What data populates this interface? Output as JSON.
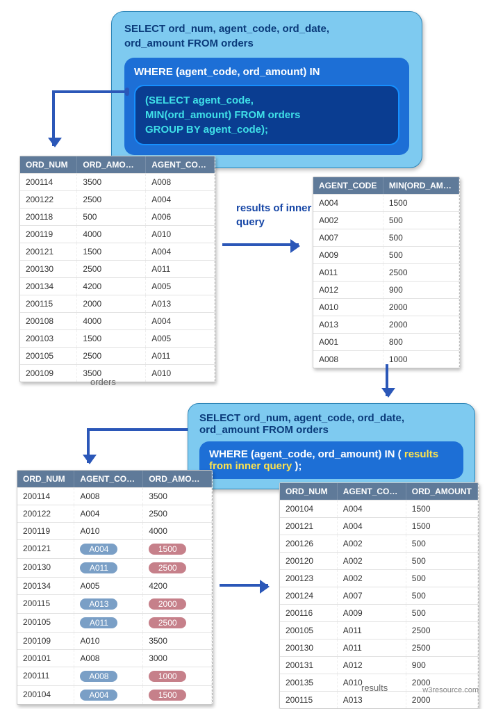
{
  "boxes": {
    "outer_l1": "SELECT ord_num, agent_code, ord_date,",
    "outer_l2": "ord_amount  FROM orders",
    "mid_l1": "WHERE (agent_code, ord_amount) IN",
    "inner_l1": "(SELECT agent_code,",
    "inner_l2": "MIN(ord_amount) FROM orders",
    "inner_l3": "GROUP BY agent_code);",
    "sql2_l1": "SELECT ord_num, agent_code, ord_date,",
    "sql2_l2": "ord_amount FROM orders",
    "sql2_where_pre": "WHERE (agent_code, ord_amount) IN ( ",
    "sql2_where_res": "results from inner query",
    "sql2_where_post": " );"
  },
  "labels": {
    "results_of_inner": "results of inner query",
    "orders_caption": "orders",
    "results_caption": "results",
    "watermark": "w3resource.com"
  },
  "orders_table": {
    "headers": [
      "ORD_NUM",
      "ORD_AMOUNT",
      "AGENT_CODE"
    ],
    "rows": [
      [
        "200114",
        "3500",
        "A008"
      ],
      [
        "200122",
        "2500",
        "A004"
      ],
      [
        "200118",
        "500",
        "A006"
      ],
      [
        "200119",
        "4000",
        "A010"
      ],
      [
        "200121",
        "1500",
        "A004"
      ],
      [
        "200130",
        "2500",
        "A011"
      ],
      [
        "200134",
        "4200",
        "A005"
      ],
      [
        "200115",
        "2000",
        "A013"
      ],
      [
        "200108",
        "4000",
        "A004"
      ],
      [
        "200103",
        "1500",
        "A005"
      ],
      [
        "200105",
        "2500",
        "A011"
      ],
      [
        "200109",
        "3500",
        "A010"
      ]
    ]
  },
  "inner_result_table": {
    "headers": [
      "AGENT_CODE",
      "MIN(ORD_AMOUNT)"
    ],
    "rows": [
      [
        "A004",
        "1500"
      ],
      [
        "A002",
        "500"
      ],
      [
        "A007",
        "500"
      ],
      [
        "A009",
        "500"
      ],
      [
        "A011",
        "2500"
      ],
      [
        "A012",
        "900"
      ],
      [
        "A010",
        "2000"
      ],
      [
        "A013",
        "2000"
      ],
      [
        "A001",
        "800"
      ],
      [
        "A008",
        "1000"
      ]
    ]
  },
  "match_table": {
    "headers": [
      "ORD_NUM",
      "AGENT_CODE",
      "ORD_AMOUNT"
    ],
    "rows": [
      {
        "cells": [
          "200114",
          "A008",
          "3500"
        ],
        "hl": [
          false,
          false,
          false
        ]
      },
      {
        "cells": [
          "200122",
          "A004",
          "2500"
        ],
        "hl": [
          false,
          false,
          false
        ]
      },
      {
        "cells": [
          "200119",
          "A010",
          "4000"
        ],
        "hl": [
          false,
          false,
          false
        ]
      },
      {
        "cells": [
          "200121",
          "A004",
          "1500"
        ],
        "hl": [
          false,
          true,
          true
        ]
      },
      {
        "cells": [
          "200130",
          "A011",
          "2500"
        ],
        "hl": [
          false,
          true,
          true
        ]
      },
      {
        "cells": [
          "200134",
          "A005",
          "4200"
        ],
        "hl": [
          false,
          false,
          false
        ]
      },
      {
        "cells": [
          "200115",
          "A013",
          "2000"
        ],
        "hl": [
          false,
          true,
          true
        ]
      },
      {
        "cells": [
          "200105",
          "A011",
          "2500"
        ],
        "hl": [
          false,
          true,
          true
        ]
      },
      {
        "cells": [
          "200109",
          "A010",
          "3500"
        ],
        "hl": [
          false,
          false,
          false
        ]
      },
      {
        "cells": [
          "200101",
          "A008",
          "3000"
        ],
        "hl": [
          false,
          false,
          false
        ]
      },
      {
        "cells": [
          "200111",
          "A008",
          "1000"
        ],
        "hl": [
          false,
          true,
          true
        ]
      },
      {
        "cells": [
          "200104",
          "A004",
          "1500"
        ],
        "hl": [
          false,
          true,
          true
        ]
      }
    ]
  },
  "results_table": {
    "headers": [
      "ORD_NUM",
      "AGENT_CODE",
      "ORD_AMOUNT"
    ],
    "rows": [
      [
        "200104",
        "A004",
        "1500"
      ],
      [
        "200121",
        "A004",
        "1500"
      ],
      [
        "200126",
        "A002",
        "500"
      ],
      [
        "200120",
        "A002",
        "500"
      ],
      [
        "200123",
        "A002",
        "500"
      ],
      [
        "200124",
        "A007",
        "500"
      ],
      [
        "200116",
        "A009",
        "500"
      ],
      [
        "200105",
        "A011",
        "2500"
      ],
      [
        "200130",
        "A011",
        "2500"
      ],
      [
        "200131",
        "A012",
        "900"
      ],
      [
        "200135",
        "A010",
        "2000"
      ],
      [
        "200115",
        "A013",
        "2000"
      ]
    ]
  },
  "colw": {
    "orders": [
      80,
      100,
      100
    ],
    "inner": [
      100,
      110
    ],
    "match": [
      80,
      100,
      100
    ],
    "results": [
      80,
      100,
      105
    ]
  }
}
